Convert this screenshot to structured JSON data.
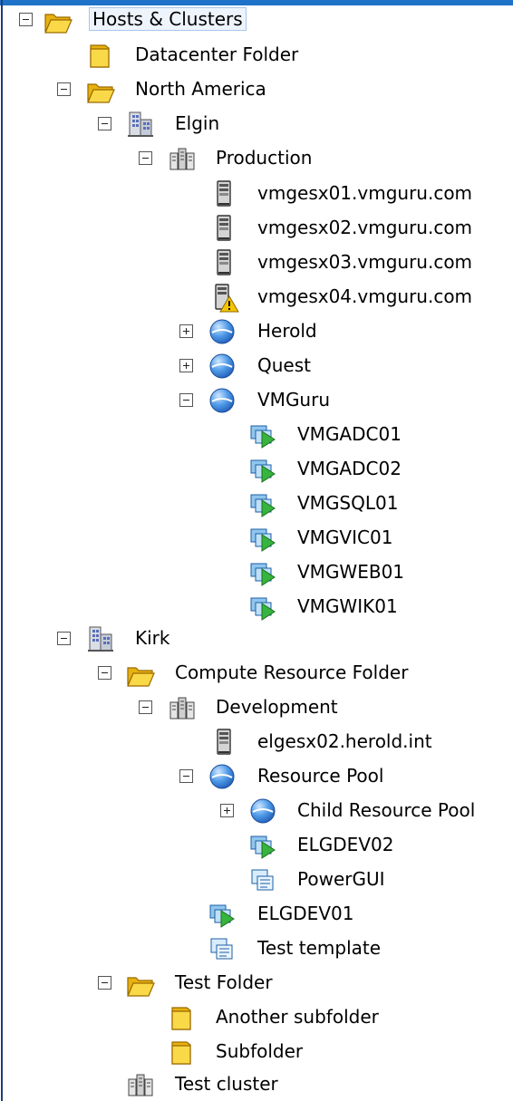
{
  "tree": {
    "root": "Hosts & Clusters",
    "datacenter_folder": "Datacenter Folder",
    "north_america": "North America",
    "elgin": "Elgin",
    "production": "Production",
    "host1": "vmgesx01.vmguru.com",
    "host2": "vmgesx02.vmguru.com",
    "host3": "vmgesx03.vmguru.com",
    "host4": "vmgesx04.vmguru.com",
    "herold": "Herold",
    "quest": "Quest",
    "vmguru": "VMGuru",
    "vm1": "VMGADC01",
    "vm2": "VMGADC02",
    "vm3": "VMGSQL01",
    "vm4": "VMGVIC01",
    "vm5": "VMGWEB01",
    "vm6": "VMGWIK01",
    "kirk": "Kirk",
    "compute_folder": "Compute Resource Folder",
    "development": "Development",
    "dev_host": "elgesx02.herold.int",
    "resource_pool": "Resource Pool",
    "child_pool": "Child Resource Pool",
    "elgdev02": "ELGDEV02",
    "powergui": "PowerGUI",
    "elgdev01": "ELGDEV01",
    "test_template": "Test template",
    "test_folder": "Test Folder",
    "another_subfolder": "Another subfolder",
    "subfolder": "Subfolder",
    "test_cluster": "Test cluster"
  },
  "colors": {
    "folder": "#f2c419",
    "pool": "#3b8fe0",
    "vm_green": "#2fae3a",
    "template_blue": "#3d8fd8"
  }
}
